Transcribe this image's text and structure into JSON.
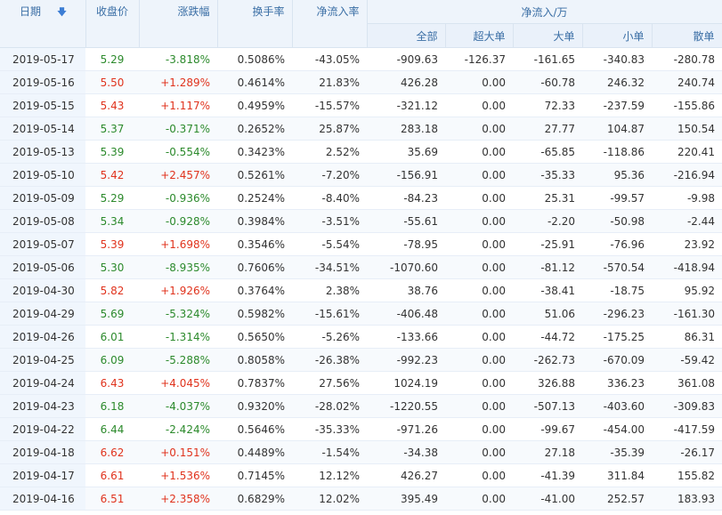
{
  "header": {
    "date": "日期",
    "sort_arrow": "🡇",
    "close": "收盘价",
    "change": "涨跌幅",
    "turnover": "换手率",
    "net_inflow_rate": "净流入率",
    "net_inflow_group": "净流入/万",
    "sub": {
      "all": "全部",
      "super_large": "超大单",
      "large": "大单",
      "small": "小单",
      "retail": "散单"
    }
  },
  "rows": [
    {
      "date": "2019-05-17",
      "close": "5.29",
      "chg": "-3.818%",
      "turnover": "0.5086%",
      "rate": "-43.05%",
      "all": "-909.63",
      "super": "-126.37",
      "large": "-161.65",
      "small": "-340.83",
      "retail": "-280.78",
      "trend": "down"
    },
    {
      "date": "2019-05-16",
      "close": "5.50",
      "chg": "+1.289%",
      "turnover": "0.4614%",
      "rate": "21.83%",
      "all": "426.28",
      "super": "0.00",
      "large": "-60.78",
      "small": "246.32",
      "retail": "240.74",
      "trend": "up"
    },
    {
      "date": "2019-05-15",
      "close": "5.43",
      "chg": "+1.117%",
      "turnover": "0.4959%",
      "rate": "-15.57%",
      "all": "-321.12",
      "super": "0.00",
      "large": "72.33",
      "small": "-237.59",
      "retail": "-155.86",
      "trend": "up"
    },
    {
      "date": "2019-05-14",
      "close": "5.37",
      "chg": "-0.371%",
      "turnover": "0.2652%",
      "rate": "25.87%",
      "all": "283.18",
      "super": "0.00",
      "large": "27.77",
      "small": "104.87",
      "retail": "150.54",
      "trend": "down"
    },
    {
      "date": "2019-05-13",
      "close": "5.39",
      "chg": "-0.554%",
      "turnover": "0.3423%",
      "rate": "2.52%",
      "all": "35.69",
      "super": "0.00",
      "large": "-65.85",
      "small": "-118.86",
      "retail": "220.41",
      "trend": "down"
    },
    {
      "date": "2019-05-10",
      "close": "5.42",
      "chg": "+2.457%",
      "turnover": "0.5261%",
      "rate": "-7.20%",
      "all": "-156.91",
      "super": "0.00",
      "large": "-35.33",
      "small": "95.36",
      "retail": "-216.94",
      "trend": "up"
    },
    {
      "date": "2019-05-09",
      "close": "5.29",
      "chg": "-0.936%",
      "turnover": "0.2524%",
      "rate": "-8.40%",
      "all": "-84.23",
      "super": "0.00",
      "large": "25.31",
      "small": "-99.57",
      "retail": "-9.98",
      "trend": "down"
    },
    {
      "date": "2019-05-08",
      "close": "5.34",
      "chg": "-0.928%",
      "turnover": "0.3984%",
      "rate": "-3.51%",
      "all": "-55.61",
      "super": "0.00",
      "large": "-2.20",
      "small": "-50.98",
      "retail": "-2.44",
      "trend": "down"
    },
    {
      "date": "2019-05-07",
      "close": "5.39",
      "chg": "+1.698%",
      "turnover": "0.3546%",
      "rate": "-5.54%",
      "all": "-78.95",
      "super": "0.00",
      "large": "-25.91",
      "small": "-76.96",
      "retail": "23.92",
      "trend": "up"
    },
    {
      "date": "2019-05-06",
      "close": "5.30",
      "chg": "-8.935%",
      "turnover": "0.7606%",
      "rate": "-34.51%",
      "all": "-1070.60",
      "super": "0.00",
      "large": "-81.12",
      "small": "-570.54",
      "retail": "-418.94",
      "trend": "down"
    },
    {
      "date": "2019-04-30",
      "close": "5.82",
      "chg": "+1.926%",
      "turnover": "0.3764%",
      "rate": "2.38%",
      "all": "38.76",
      "super": "0.00",
      "large": "-38.41",
      "small": "-18.75",
      "retail": "95.92",
      "trend": "up"
    },
    {
      "date": "2019-04-29",
      "close": "5.69",
      "chg": "-5.324%",
      "turnover": "0.5982%",
      "rate": "-15.61%",
      "all": "-406.48",
      "super": "0.00",
      "large": "51.06",
      "small": "-296.23",
      "retail": "-161.30",
      "trend": "down"
    },
    {
      "date": "2019-04-26",
      "close": "6.01",
      "chg": "-1.314%",
      "turnover": "0.5650%",
      "rate": "-5.26%",
      "all": "-133.66",
      "super": "0.00",
      "large": "-44.72",
      "small": "-175.25",
      "retail": "86.31",
      "trend": "down"
    },
    {
      "date": "2019-04-25",
      "close": "6.09",
      "chg": "-5.288%",
      "turnover": "0.8058%",
      "rate": "-26.38%",
      "all": "-992.23",
      "super": "0.00",
      "large": "-262.73",
      "small": "-670.09",
      "retail": "-59.42",
      "trend": "down"
    },
    {
      "date": "2019-04-24",
      "close": "6.43",
      "chg": "+4.045%",
      "turnover": "0.7837%",
      "rate": "27.56%",
      "all": "1024.19",
      "super": "0.00",
      "large": "326.88",
      "small": "336.23",
      "retail": "361.08",
      "trend": "up"
    },
    {
      "date": "2019-04-23",
      "close": "6.18",
      "chg": "-4.037%",
      "turnover": "0.9320%",
      "rate": "-28.02%",
      "all": "-1220.55",
      "super": "0.00",
      "large": "-507.13",
      "small": "-403.60",
      "retail": "-309.83",
      "trend": "down"
    },
    {
      "date": "2019-04-22",
      "close": "6.44",
      "chg": "-2.424%",
      "turnover": "0.5646%",
      "rate": "-35.33%",
      "all": "-971.26",
      "super": "0.00",
      "large": "-99.67",
      "small": "-454.00",
      "retail": "-417.59",
      "trend": "down"
    },
    {
      "date": "2019-04-18",
      "close": "6.62",
      "chg": "+0.151%",
      "turnover": "0.4489%",
      "rate": "-1.54%",
      "all": "-34.38",
      "super": "0.00",
      "large": "27.18",
      "small": "-35.39",
      "retail": "-26.17",
      "trend": "up"
    },
    {
      "date": "2019-04-17",
      "close": "6.61",
      "chg": "+1.536%",
      "turnover": "0.7145%",
      "rate": "12.12%",
      "all": "426.27",
      "super": "0.00",
      "large": "-41.39",
      "small": "311.84",
      "retail": "155.82",
      "trend": "up"
    },
    {
      "date": "2019-04-16",
      "close": "6.51",
      "chg": "+2.358%",
      "turnover": "0.6829%",
      "rate": "12.02%",
      "all": "395.49",
      "super": "0.00",
      "large": "-41.00",
      "small": "252.57",
      "retail": "183.93",
      "trend": "up"
    }
  ],
  "colors": {
    "up": "#e0331d",
    "down": "#2c8a2c",
    "header_text": "#3a6ea5",
    "header_bg": "#eef4fb"
  }
}
